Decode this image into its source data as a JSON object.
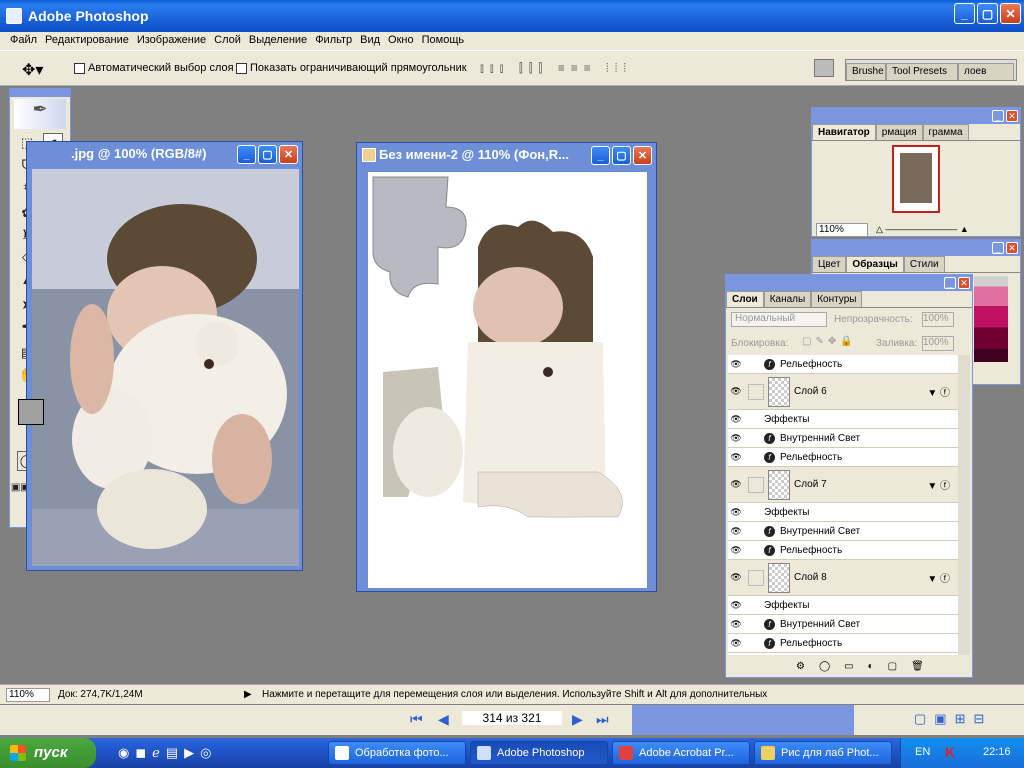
{
  "app": {
    "title": "Adobe Photoshop"
  },
  "menu": [
    "Файл",
    "Редактирование",
    "Изображение",
    "Слой",
    "Выделение",
    "Фильтр",
    "Вид",
    "Окно",
    "Помощь"
  ],
  "options": {
    "auto_select": "Автоматический выбор слоя",
    "show_bounds": "Показать ограничивающий прямоугольник",
    "brushes_tab": "Brushe",
    "tool_presets_tab": "Tool Presets",
    "layers_tab": "лоев"
  },
  "doc1": {
    "title": ".jpg @ 100% (RGB/8#)"
  },
  "doc2": {
    "title": "Без имени-2 @ 110% (Фон,R..."
  },
  "navigator": {
    "tabs": [
      "Навигатор",
      "рмация",
      "грамма"
    ],
    "zoom": "110%"
  },
  "swatches": {
    "tabs": [
      "Цвет",
      "Образцы",
      "Стили"
    ]
  },
  "layers": {
    "tabs": [
      "Слои",
      "Каналы",
      "Контуры"
    ],
    "blend": "Нормальный",
    "opacity_label": "Непрозрачность:",
    "opacity": "100%",
    "lock_label": "Блокировка:",
    "fill_label": "Заливка:",
    "fill": "100%",
    "rows": [
      {
        "type": "effect",
        "label": "Рельефность"
      },
      {
        "type": "layer",
        "label": "Слой 6"
      },
      {
        "type": "effects",
        "label": "Эффекты"
      },
      {
        "type": "effect",
        "label": "Внутренний Свет"
      },
      {
        "type": "effect",
        "label": "Рельефность"
      },
      {
        "type": "layer",
        "label": "Слой 7"
      },
      {
        "type": "effects",
        "label": "Эффекты"
      },
      {
        "type": "effect",
        "label": "Внутренний Свет"
      },
      {
        "type": "effect",
        "label": "Рельефность"
      },
      {
        "type": "layer",
        "label": "Слой 8"
      },
      {
        "type": "effects",
        "label": "Эффекты"
      },
      {
        "type": "effect",
        "label": "Внутренний Свет"
      },
      {
        "type": "effect",
        "label": "Рельефность"
      }
    ]
  },
  "status": {
    "zoom": "110%",
    "doc": "Док: 274,7K/1,24M",
    "hint": "Нажмите и перетащите для перемещения слоя или выделения. Используйте Shift и Alt для дополнительных"
  },
  "pager": {
    "text": "314 из 321"
  },
  "taskbar": {
    "start": "пуск",
    "tasks": [
      "Обработка фото...",
      "Adobe Photoshop",
      "Adobe Acrobat Pr...",
      "Рис для лаб Phot..."
    ],
    "lang": "EN",
    "time": "22:16"
  },
  "colors": {
    "accent": "#0a5fd8",
    "canvas": "#808080",
    "panel": "#ece9d8"
  }
}
